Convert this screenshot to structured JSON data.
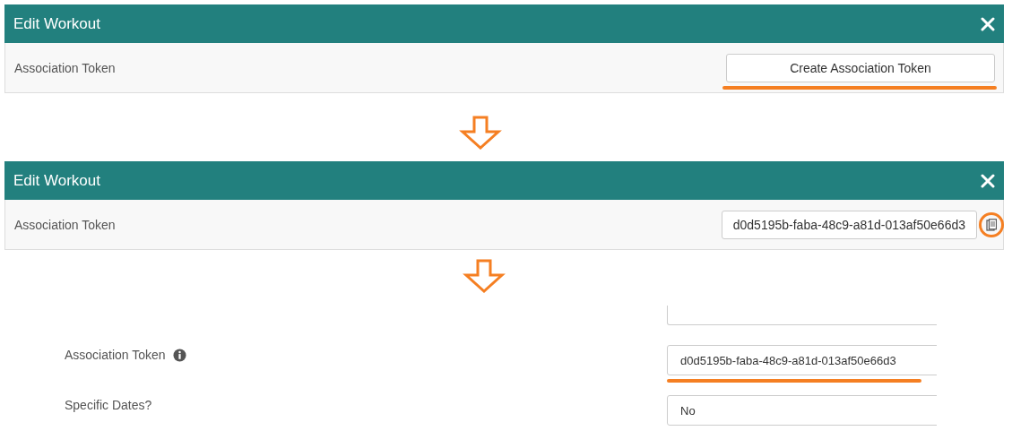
{
  "steps": [
    {
      "kind": "create",
      "title": "Edit Workout",
      "label": "Association Token",
      "button": "Create Association Token",
      "highlighted": true
    },
    {
      "kind": "token",
      "title": "Edit Workout",
      "label": "Association Token",
      "value": "d0d5195b-faba-48c9-a81d-013af50e66d3",
      "highlighted": true
    },
    {
      "kind": "form",
      "fields": [
        {
          "label": "Association Token",
          "info": true,
          "value": "d0d5195b-faba-48c9-a81d-013af50e66d3",
          "highlighted": true
        },
        {
          "label": "Specific Dates?",
          "info": false,
          "value": "No",
          "highlighted": false
        }
      ]
    }
  ]
}
